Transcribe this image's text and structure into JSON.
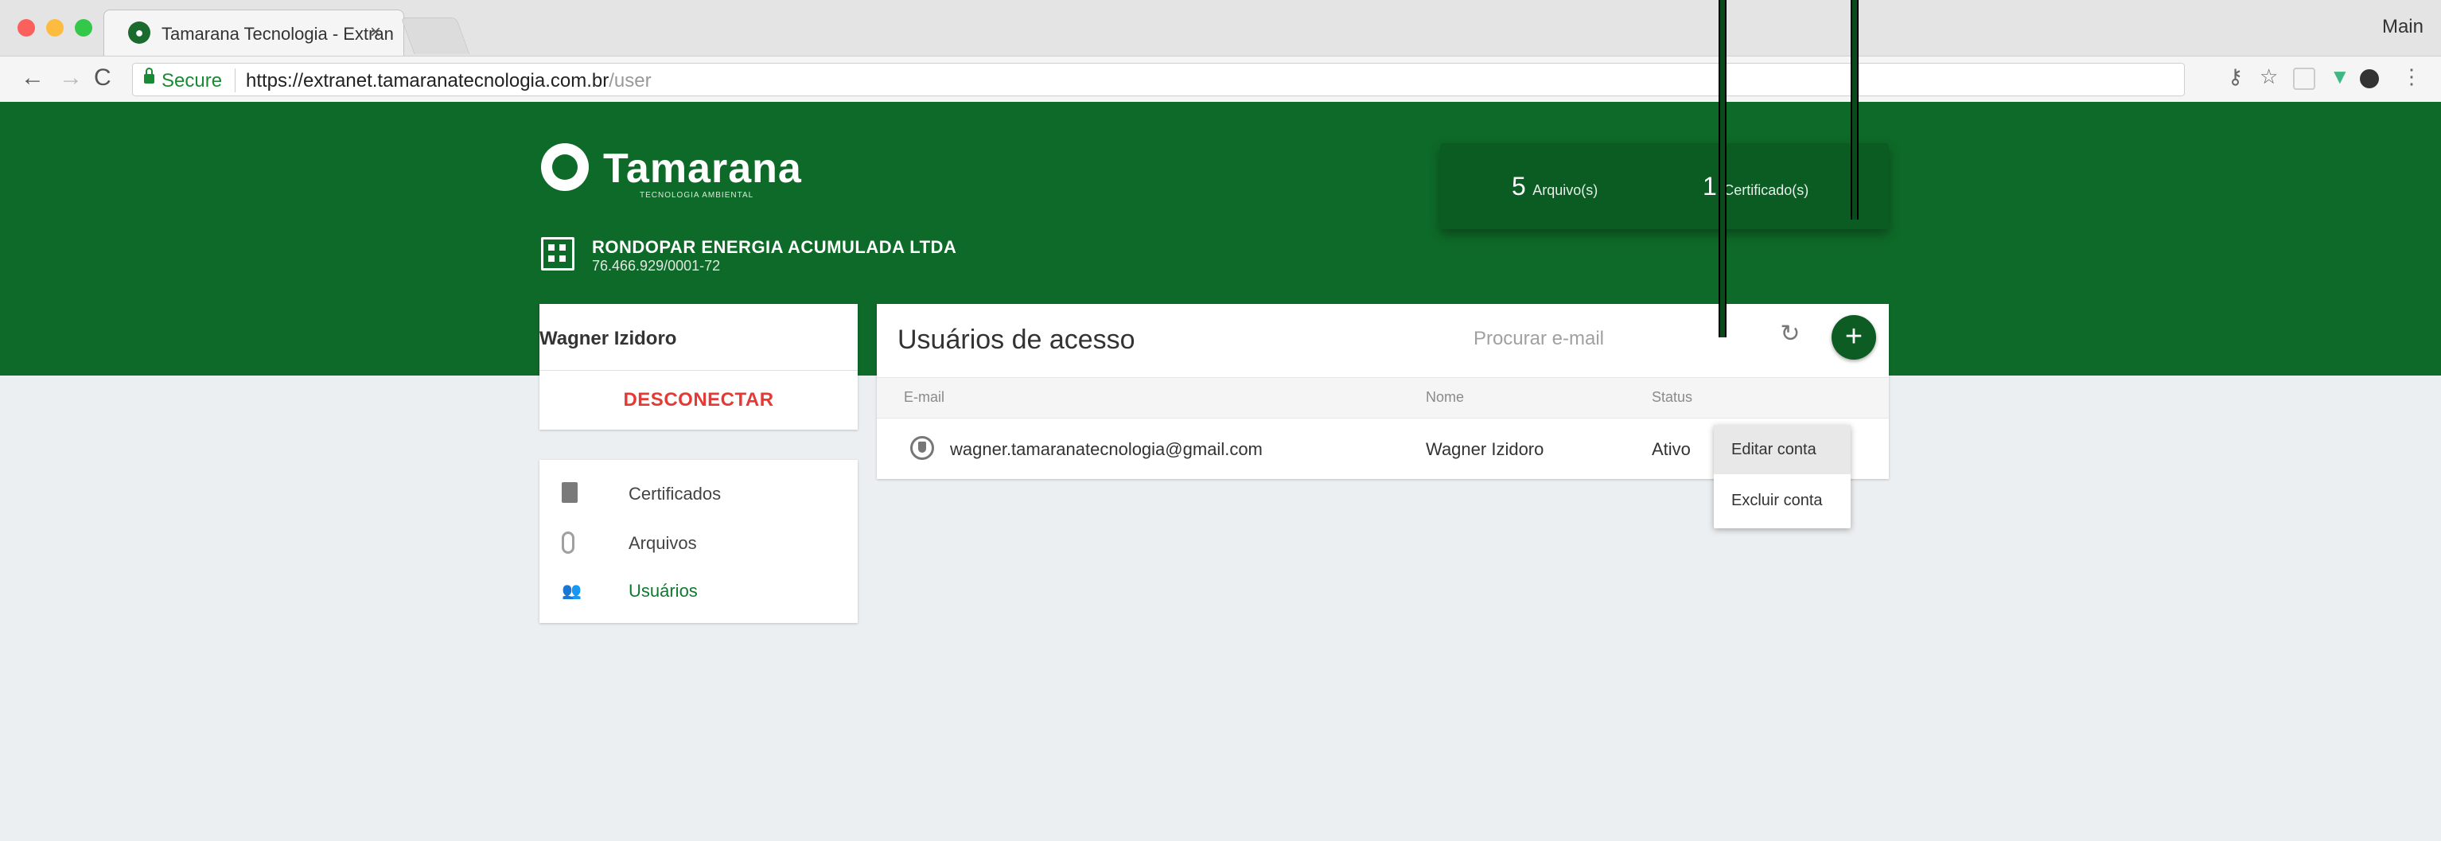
{
  "browser": {
    "tab_title": "Tamarana Tecnologia - Extran",
    "tab_close": "×",
    "profile": "Main",
    "secure_label": "Secure",
    "url_host": "https://extranet.tamaranatecnologia.com.br",
    "url_path": "/user",
    "nav_back": "←",
    "nav_forward": "→",
    "nav_reload": "C",
    "key_icon": "⚷",
    "star_icon": "☆",
    "vue_icon": "▼",
    "menu_icon": "⋮"
  },
  "brand": {
    "name": "Tamarana",
    "tagline": "TECNOLOGIA AMBIENTAL",
    "primary_color": "#0e6a28"
  },
  "company": {
    "name": "RONDOPAR ENERGIA ACUMULADA LTDA",
    "cnpj": "76.466.929/0001-72"
  },
  "stats": {
    "files_count": "5",
    "files_label": "Arquivo(s)",
    "certs_count": "1",
    "certs_label": "Certificado(s)"
  },
  "user": {
    "name": "Wagner Izidoro",
    "logout_label": "DESCONECTAR"
  },
  "menu": {
    "items": [
      {
        "label": "Certificados",
        "icon": "document-icon"
      },
      {
        "label": "Arquivos",
        "icon": "paperclip-icon"
      },
      {
        "label": "Usuários",
        "icon": "users-icon",
        "active": true
      }
    ]
  },
  "users_panel": {
    "title": "Usuários de acesso",
    "search_placeholder": "Procurar e-mail",
    "refresh_icon": "↻",
    "add_icon": "+",
    "columns": {
      "email": "E-mail",
      "name": "Nome",
      "status": "Status"
    },
    "rows": [
      {
        "email": "wagner.tamaranatecnologia@gmail.com",
        "name": "Wagner Izidoro",
        "status": "Ativo"
      }
    ]
  },
  "context_menu": {
    "edit": "Editar conta",
    "delete": "Excluir conta"
  }
}
